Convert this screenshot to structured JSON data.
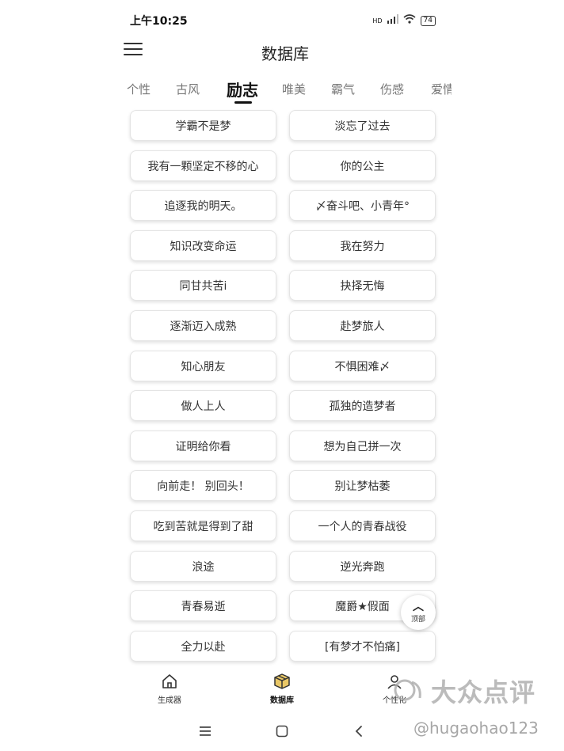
{
  "status_bar": {
    "time": "上午10:25",
    "signal_label": "HD",
    "battery": "74"
  },
  "header": {
    "title": "数据库"
  },
  "tabs": [
    {
      "label": "个性"
    },
    {
      "label": "古风"
    },
    {
      "label": "励志",
      "active": true
    },
    {
      "label": "唯美"
    },
    {
      "label": "霸气"
    },
    {
      "label": "伤感"
    },
    {
      "label": "爱情"
    }
  ],
  "names": [
    "学霸不是梦",
    "淡忘了过去",
    "我有一颗坚定不移的心",
    "你的公主",
    "追逐我的明天。",
    "〆奋斗吧、小青年°",
    "知识改变命运",
    "我在努力",
    "同甘共苦i",
    "抉择无悔",
    "逐渐迈入成熟",
    "赴梦旅人",
    "知心朋友",
    "不惧困难〆",
    "做人上人",
    "孤独的造梦者",
    "证明给你看",
    "想为自己拼一次",
    "向前走！ 别回头！",
    "别让梦枯萎",
    "吃到苦就是得到了甜",
    "一个人的青春战役",
    "浪途",
    "逆光奔跑",
    "青春易逝",
    "魔爵★假面",
    "全力以赴",
    "[有梦才不怕痛]"
  ],
  "back_to_top": {
    "label": "顶部"
  },
  "bottom_nav": [
    {
      "label": "生成器",
      "icon": "home-icon"
    },
    {
      "label": "数据库",
      "icon": "box-icon",
      "active": true
    },
    {
      "label": "个性化",
      "icon": "person-icon"
    }
  ],
  "watermark": {
    "brand": "大众点评",
    "user": "@hugaohao123"
  },
  "colors": {
    "accent": "#111111",
    "tab_inactive": "#777777",
    "box_icon": "#d4a83a"
  }
}
